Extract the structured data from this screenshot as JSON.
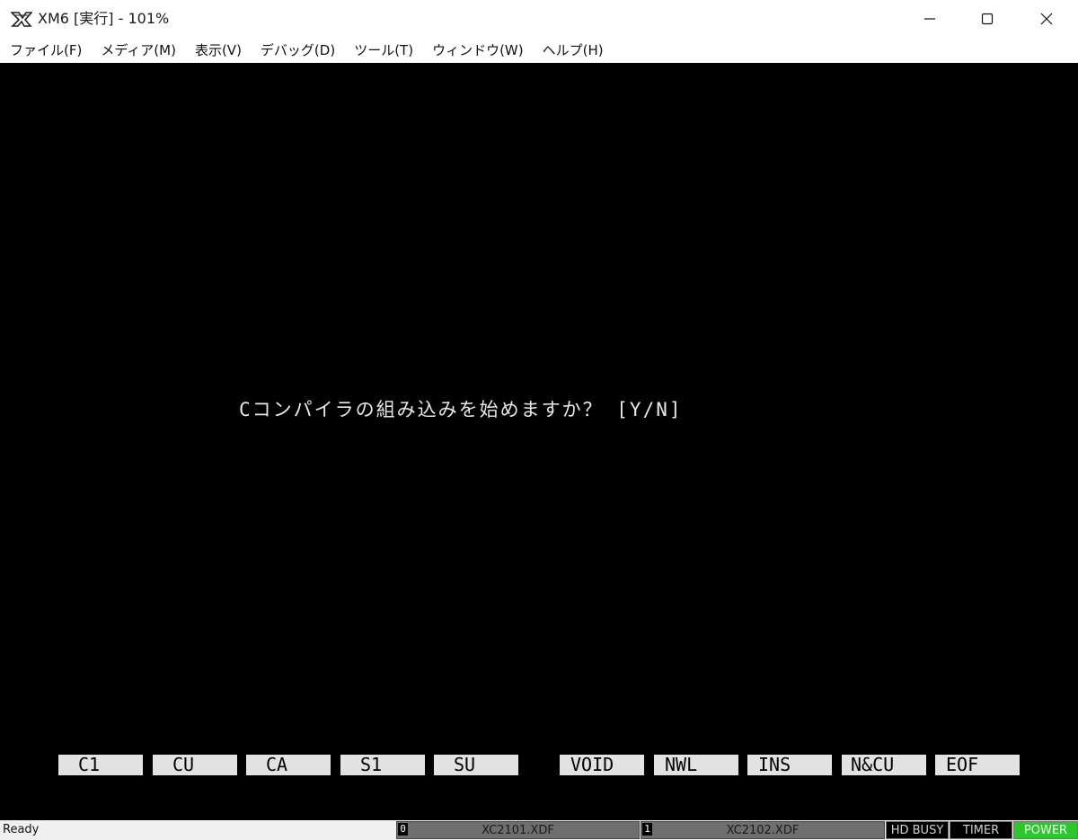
{
  "window": {
    "title": "XM6 [実行] - 101%",
    "icon": "xm6-logo-icon",
    "controls": [
      "minimize-icon",
      "maximize-icon",
      "close-icon"
    ]
  },
  "menu": [
    {
      "label": "ファイル(F)"
    },
    {
      "label": "メディア(M)"
    },
    {
      "label": "表示(V)"
    },
    {
      "label": "デバッグ(D)"
    },
    {
      "label": "ツール(T)"
    },
    {
      "label": "ウィンドウ(W)"
    },
    {
      "label": "ヘルプ(H)"
    }
  ],
  "screen": {
    "prompt": "Cコンパイラの組み込みを始めますか？ [Y/N]",
    "function_keys": [
      "C1",
      "CU",
      "CA",
      "S1",
      "SU",
      "VOID",
      "NWL",
      "INS",
      "N&CU",
      "EOF"
    ]
  },
  "statusbar": {
    "status": "Ready",
    "drive0": {
      "number": "0",
      "file": "XC2101.XDF"
    },
    "drive1": {
      "number": "1",
      "file": "XC2102.XDF"
    },
    "indicators": [
      "HD BUSY",
      "TIMER",
      "POWER"
    ]
  },
  "colors": {
    "screen_bg": "#000000",
    "text": "#e8e8e8",
    "fkey_bg": "#e2e2e2",
    "power_led": "#2ec52e"
  }
}
